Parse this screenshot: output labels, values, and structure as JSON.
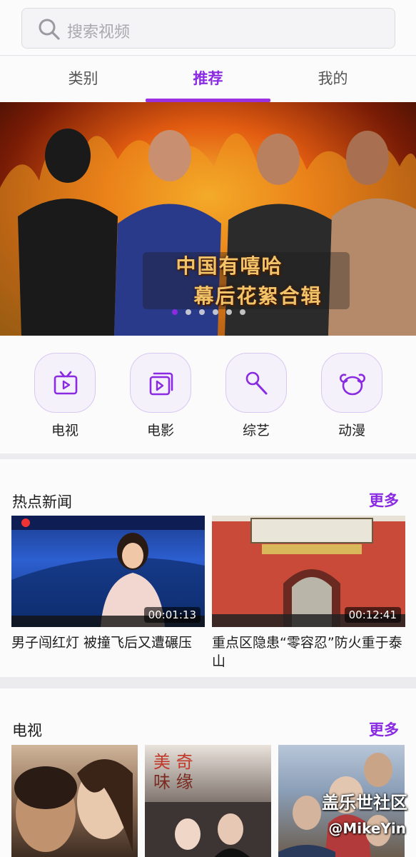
{
  "search": {
    "placeholder": "搜索视频"
  },
  "tabs": [
    {
      "label": "类别",
      "active": false
    },
    {
      "label": "推荐",
      "active": true
    },
    {
      "label": "我的",
      "active": false
    }
  ],
  "banner": {
    "title_line1": "中国有嘻哈",
    "title_line2": "幕后花絮合辑",
    "dot_count": 6,
    "active_dot": 0
  },
  "categories": [
    {
      "label": "电视",
      "icon": "tv-icon"
    },
    {
      "label": "电影",
      "icon": "film-icon"
    },
    {
      "label": "综艺",
      "icon": "microphone-icon"
    },
    {
      "label": "动漫",
      "icon": "bear-icon"
    }
  ],
  "hot_news": {
    "title": "热点新闻",
    "more": "更多",
    "items": [
      {
        "caption": "男子闯红灯 被撞飞后又遭碾压",
        "duration": "00:01:13"
      },
      {
        "caption": "重点区隐患“零容忍”防火重于泰山",
        "duration": "00:12:41"
      }
    ]
  },
  "tv": {
    "title": "电视",
    "more": "更多"
  },
  "watermark": {
    "line1": "盖乐世社区",
    "line2": "@MikeYin"
  },
  "colors": {
    "accent": "#8a2be2"
  }
}
